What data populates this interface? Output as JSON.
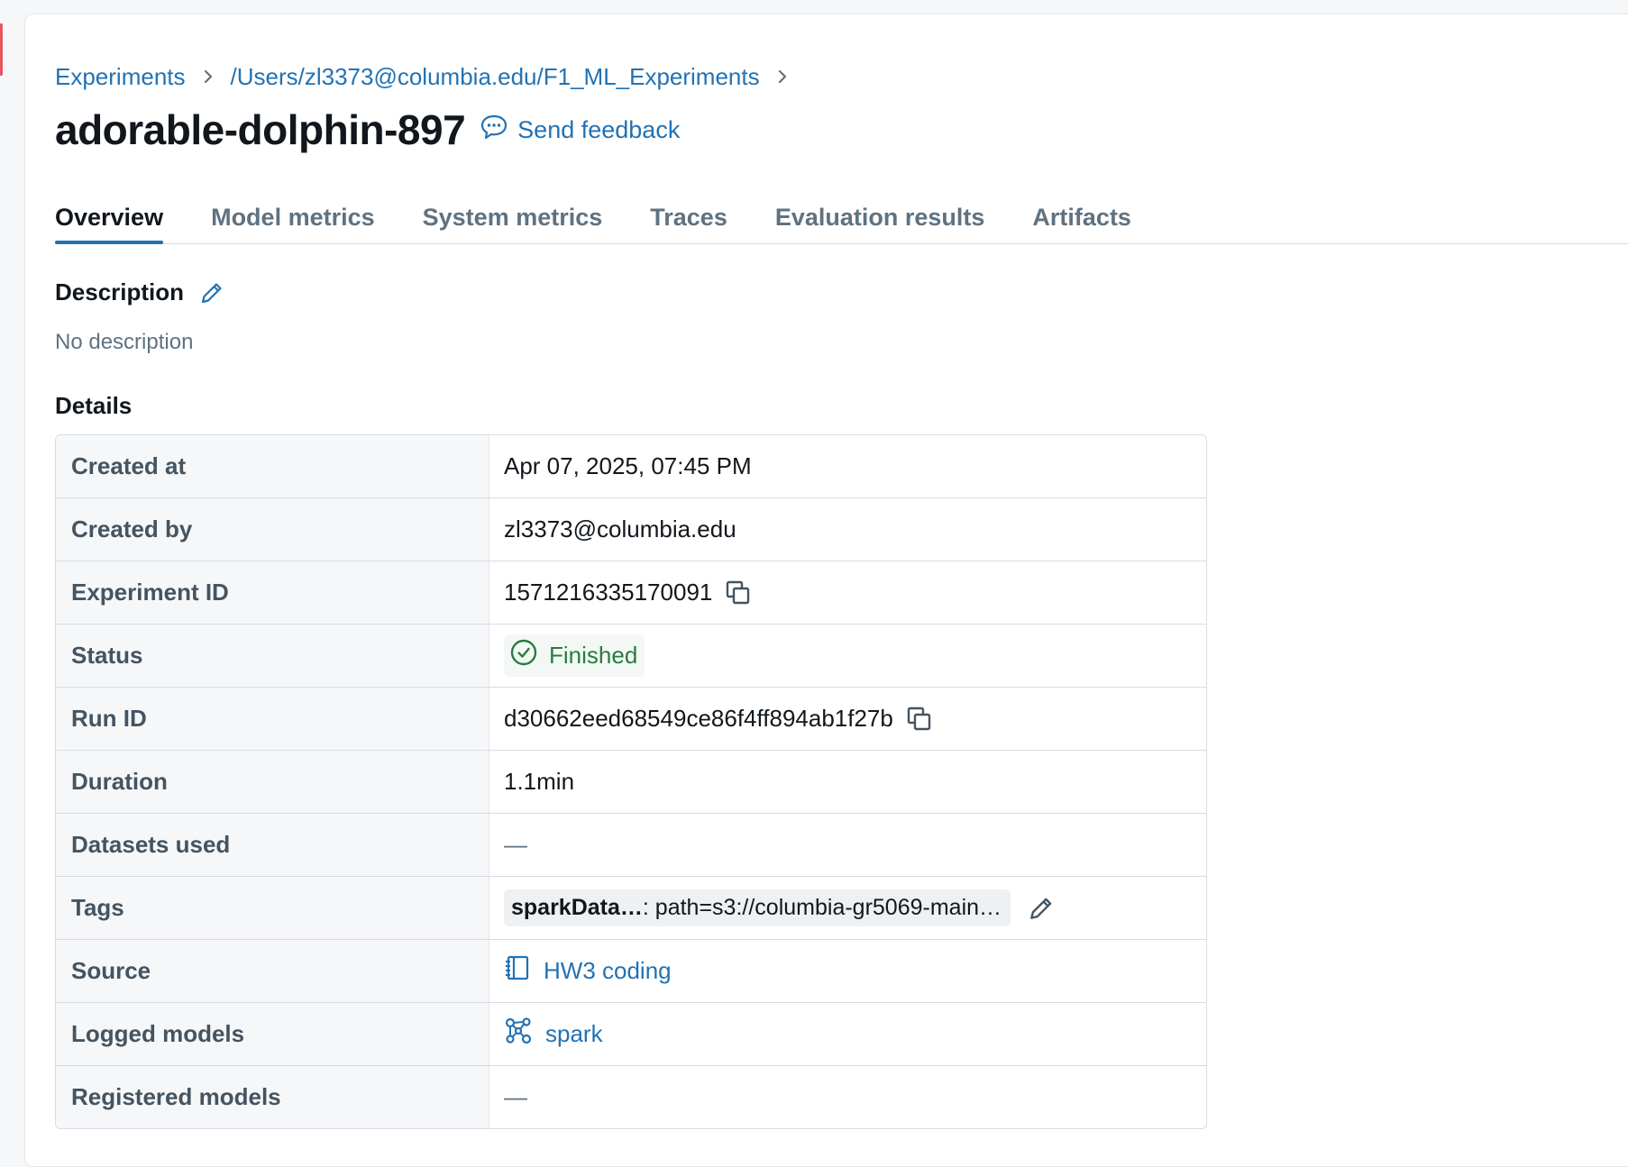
{
  "breadcrumb": {
    "items": [
      "Experiments",
      "/Users/zl3373@columbia.edu/F1_ML_Experiments"
    ]
  },
  "header": {
    "title": "adorable-dolphin-897",
    "feedback_label": "Send feedback"
  },
  "tabs": [
    {
      "label": "Overview",
      "active": true
    },
    {
      "label": "Model metrics",
      "active": false
    },
    {
      "label": "System metrics",
      "active": false
    },
    {
      "label": "Traces",
      "active": false
    },
    {
      "label": "Evaluation results",
      "active": false
    },
    {
      "label": "Artifacts",
      "active": false
    }
  ],
  "description": {
    "heading": "Description",
    "text": "No description"
  },
  "details": {
    "heading": "Details",
    "rows": {
      "created_at": {
        "label": "Created at",
        "value": "Apr 07, 2025, 07:45 PM"
      },
      "created_by": {
        "label": "Created by",
        "value": "zl3373@columbia.edu"
      },
      "experiment_id": {
        "label": "Experiment ID",
        "value": "1571216335170091"
      },
      "status": {
        "label": "Status",
        "value": "Finished"
      },
      "run_id": {
        "label": "Run ID",
        "value": "d30662eed68549ce86f4ff894ab1f27b"
      },
      "duration": {
        "label": "Duration",
        "value": "1.1min"
      },
      "datasets_used": {
        "label": "Datasets used",
        "value": "—"
      },
      "tags": {
        "label": "Tags",
        "tag_key": "sparkData…",
        "tag_value": ": path=s3://columbia-gr5069-main…"
      },
      "source": {
        "label": "Source",
        "value": "HW3 coding"
      },
      "logged_models": {
        "label": "Logged models",
        "value": "spark"
      },
      "registered_models": {
        "label": "Registered models",
        "value": "—"
      }
    }
  },
  "colors": {
    "link": "#2272b4",
    "success": "#277c43",
    "active_tab_underline": "#2272b4"
  },
  "icons": {
    "breadcrumb_separator": "chevron-right-icon",
    "feedback": "speech-bubble-icon",
    "edit": "pencil-icon",
    "copy": "copy-icon",
    "status": "check-circle-icon",
    "source": "notebook-icon",
    "model": "model-graph-icon"
  }
}
